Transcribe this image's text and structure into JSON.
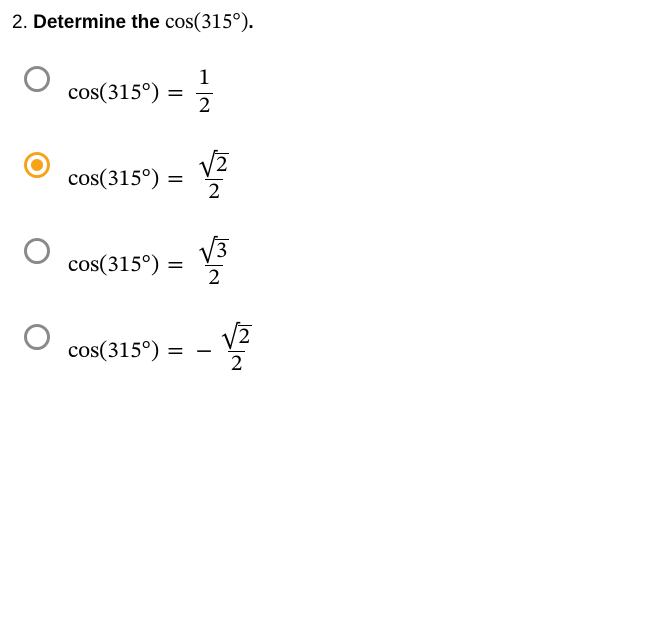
{
  "question": {
    "number": "2.",
    "prompt_bold": "Determine the",
    "prompt_math_func": "cos",
    "prompt_math_arg": "(315°)",
    "prompt_period": "."
  },
  "options": [
    {
      "selected": false,
      "lhs_func": "cos",
      "lhs_arg": "(315°)",
      "eq": "=",
      "neg": "",
      "numerator_type": "plain",
      "numerator_val": "1",
      "denominator": "2"
    },
    {
      "selected": true,
      "lhs_func": "cos",
      "lhs_arg": "(315°)",
      "eq": "=",
      "neg": "",
      "numerator_type": "sqrt",
      "numerator_val": "2",
      "denominator": "2"
    },
    {
      "selected": false,
      "lhs_func": "cos",
      "lhs_arg": "(315°)",
      "eq": "=",
      "neg": "",
      "numerator_type": "sqrt",
      "numerator_val": "3",
      "denominator": "2"
    },
    {
      "selected": false,
      "lhs_func": "cos",
      "lhs_arg": "(315°)",
      "eq": "=",
      "neg": "−",
      "numerator_type": "sqrt",
      "numerator_val": "2",
      "denominator": "2"
    }
  ]
}
